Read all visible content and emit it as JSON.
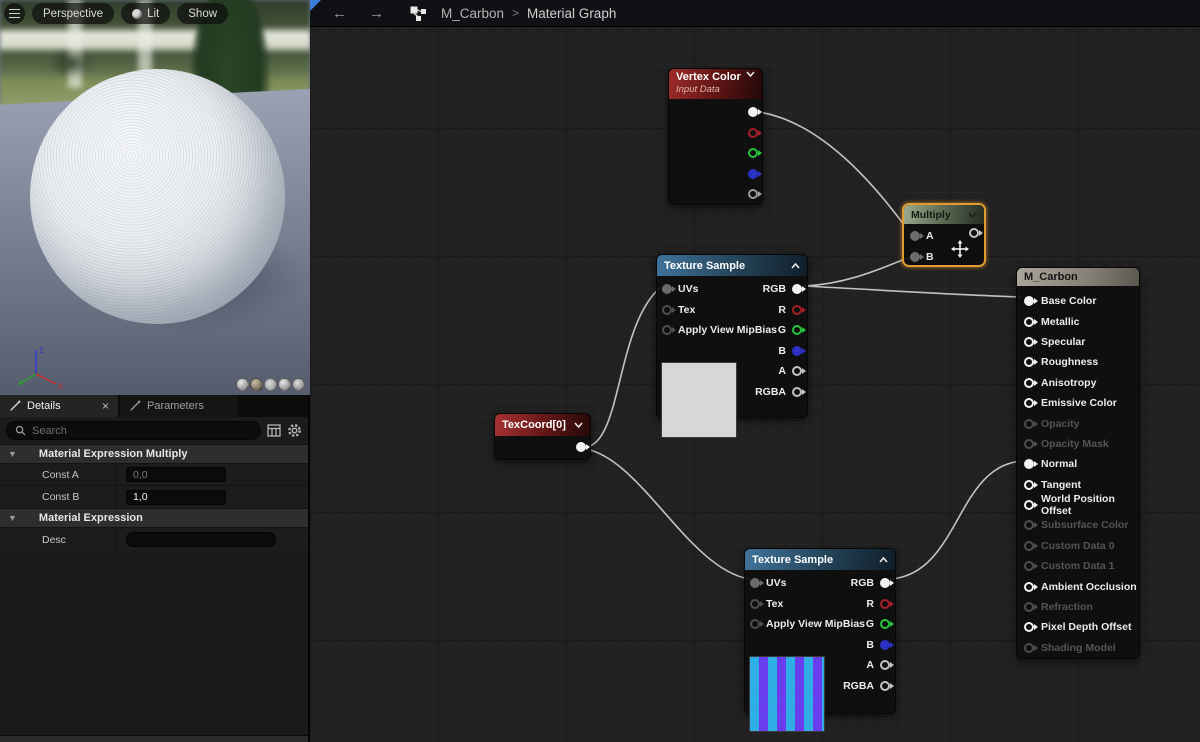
{
  "header": {
    "back_label": "←",
    "forward_label": "→",
    "breadcrumb_root": "M_Carbon",
    "breadcrumb_separator": ">",
    "breadcrumb_page": "Material Graph"
  },
  "viewport": {
    "buttons": {
      "perspective": "Perspective",
      "lit": "Lit",
      "show": "Show"
    },
    "gizmo": {
      "z": "z",
      "x": "x",
      "y": "y"
    }
  },
  "details": {
    "tabs": {
      "details": "Details",
      "parameters": "Parameters",
      "close": "×"
    },
    "search": {
      "placeholder": "Search"
    },
    "sections": [
      {
        "title": "Material Expression Multiply",
        "caret": "▼",
        "rows": [
          {
            "label": "Const A",
            "value": "0,0"
          },
          {
            "label": "Const B",
            "value": "1,0"
          }
        ]
      },
      {
        "title": "Material Expression",
        "caret": "▼",
        "rows": [
          {
            "label": "Desc",
            "value": ""
          }
        ]
      }
    ]
  },
  "graph": {
    "nodes": {
      "vertex_color": {
        "title": "Vertex Color",
        "subtitle": "Input Data"
      },
      "multiply": {
        "title": "Multiply",
        "inputs": [
          "A",
          "B"
        ]
      },
      "texture_sample_top": {
        "title": "Texture Sample",
        "inputs": [
          "UVs",
          "Tex",
          "Apply View MipBias"
        ],
        "outputs": [
          "RGB",
          "R",
          "G",
          "B",
          "A",
          "RGBA"
        ]
      },
      "texcoord": {
        "title": "TexCoord[0]"
      },
      "texture_sample_bottom": {
        "title": "Texture Sample",
        "inputs": [
          "UVs",
          "Tex",
          "Apply View MipBias"
        ],
        "outputs": [
          "RGB",
          "R",
          "G",
          "B",
          "A",
          "RGBA"
        ]
      },
      "m_carbon": {
        "title": "M_Carbon",
        "pins": [
          {
            "label": "Base Color",
            "state": "connected"
          },
          {
            "label": "Metallic",
            "state": "open"
          },
          {
            "label": "Specular",
            "state": "open"
          },
          {
            "label": "Roughness",
            "state": "open"
          },
          {
            "label": "Anisotropy",
            "state": "open"
          },
          {
            "label": "Emissive Color",
            "state": "open"
          },
          {
            "label": "Opacity",
            "state": "disabled"
          },
          {
            "label": "Opacity Mask",
            "state": "disabled"
          },
          {
            "label": "Normal",
            "state": "connected"
          },
          {
            "label": "Tangent",
            "state": "open"
          },
          {
            "label": "World Position Offset",
            "state": "open"
          },
          {
            "label": "Subsurface Color",
            "state": "disabled"
          },
          {
            "label": "Custom Data 0",
            "state": "disabled"
          },
          {
            "label": "Custom Data 1",
            "state": "disabled"
          },
          {
            "label": "Ambient Occlusion",
            "state": "open"
          },
          {
            "label": "Refraction",
            "state": "disabled"
          },
          {
            "label": "Pixel Depth Offset",
            "state": "open"
          },
          {
            "label": "Shading Model",
            "state": "disabled"
          }
        ]
      }
    },
    "connections": [
      "VertexColor.RGB -> Multiply.A",
      "TextureSampleTop.RGB -> Multiply.B",
      "TextureSampleTop.RGB -> M_Carbon.BaseColor",
      "TexCoord0 -> TextureSampleTop.UVs",
      "TexCoord0 -> TextureSampleBottom.UVs",
      "TextureSampleBottom.RGB -> M_Carbon.Normal"
    ]
  },
  "colors": {
    "selection_orange": "#e09c2f",
    "wire": "#d0d0d0",
    "header_input_red": "#9e2b2b",
    "header_texture_blue": "#40739a",
    "header_math_green": "#9aab8e",
    "header_result_tan": "#aba69a",
    "pin_red": "#a32028",
    "pin_green": "#23c63e",
    "pin_blue": "#2d31c4",
    "graph_bg": "#212121"
  }
}
